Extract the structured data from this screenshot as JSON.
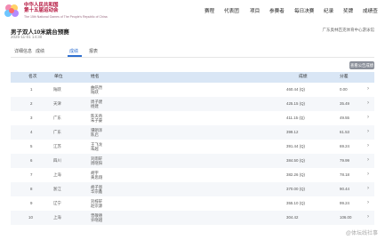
{
  "header": {
    "logo_line1": "中华人民共和国",
    "logo_line2": "第十五届运动会",
    "logo_sub": "The 15th National Games of The People's Republic of China",
    "nav": [
      "赛程",
      "代表团",
      "项目",
      "参赛者",
      "每日决赛",
      "纪录",
      "奖牌",
      "成绩查"
    ]
  },
  "event": {
    "title": "男子双人10米跳台预赛",
    "time": "2025-11-01 14:30",
    "venue": "广东奥林匹克体育中心游泳馆"
  },
  "tabs": [
    "详细信息",
    "成绩",
    "成绩",
    "报表"
  ],
  "view_btn": "查看公告成绩",
  "table": {
    "headers": [
      "名次",
      "单位",
      "姓名",
      "成绩",
      "分差"
    ],
    "rows": [
      {
        "rank": "1",
        "unit": "陆跃",
        "names": [
          "曲皓然",
          "陆跃"
        ],
        "score": "460.44 (Q)",
        "diff": "0.00"
      },
      {
        "rank": "2",
        "unit": "天津",
        "names": [
          "周子建",
          "杨建"
        ],
        "score": "425.15 (Q)",
        "diff": "35.49"
      },
      {
        "rank": "3",
        "unit": "广东",
        "names": [
          "陈天奇",
          "朱子豪"
        ],
        "score": "411.15 (Q)",
        "diff": "49.55"
      },
      {
        "rank": "4",
        "unit": "广东",
        "names": [
          "谭朗泽",
          "陈启"
        ],
        "score": "399.12",
        "diff": "61.53"
      },
      {
        "rank": "5",
        "unit": "江苏",
        "names": [
          "王飞龙",
          "朱越"
        ],
        "score": "391.44 (Q)",
        "diff": "69.24"
      },
      {
        "rank": "6",
        "unit": "四川",
        "names": [
          "刘雨轩",
          "周晓阳"
        ],
        "score": "384.50 (Q)",
        "diff": "79.99"
      },
      {
        "rank": "7",
        "unit": "上海",
        "names": [
          "胡宇",
          "黄思翔"
        ],
        "score": "382.26 (Q)",
        "diff": "78.18"
      },
      {
        "rank": "8",
        "unit": "浙江",
        "names": [
          "胡子恩",
          "华宗鑫"
        ],
        "score": "370.00 (Q)",
        "diff": "90.44"
      },
      {
        "rank": "9",
        "unit": "辽宁",
        "names": [
          "刘梓轩",
          "赵宗源"
        ],
        "score": "355.10 (Q)",
        "diff": "99.24"
      },
      {
        "rank": "10",
        "unit": "上海",
        "names": [
          "曾敬德",
          "许晓越"
        ],
        "score": "304.42",
        "diff": "106.00"
      }
    ]
  },
  "watermark": "@体坛线社事"
}
